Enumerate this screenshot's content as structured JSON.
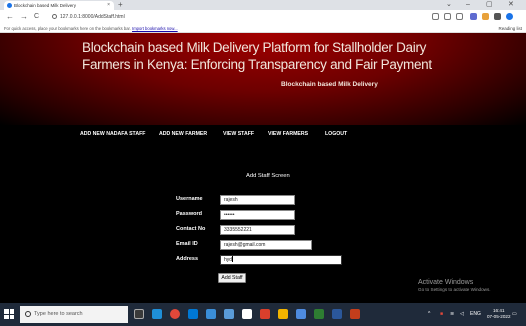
{
  "browser": {
    "tab_title": "Blockchain based Milk Delivery",
    "tab_close": "×",
    "new_tab": "+",
    "window_controls": [
      "⌄",
      "–",
      "▢",
      "✕"
    ],
    "nav": {
      "back": "←",
      "forward": "→",
      "reload": "C"
    },
    "url": "127.0.0.1:8000/AddStaff.html",
    "bookmarks_text": "For quick access, place your bookmarks here on the bookmarks bar.",
    "bookmarks_link": "Import bookmarks now...",
    "reading_list": "Reading list"
  },
  "header": {
    "title": "Blockchain based Milk Delivery Platform for Stallholder Dairy Farmers in Kenya: Enforcing Transparency and Fair Payment",
    "subtitle": "Blockchain based Milk Delivery"
  },
  "nav": {
    "items": [
      "ADD NEW NADAFA STAFF",
      "ADD NEW FARMER",
      "VIEW STAFF",
      "VIEW FARMERS",
      "LOGOUT"
    ]
  },
  "form": {
    "title": "Add Staff Screen",
    "fields": [
      {
        "label": "Username",
        "value": "rajesh"
      },
      {
        "label": "Password",
        "value": "••••••"
      },
      {
        "label": "Contact No",
        "value": "3335552221"
      },
      {
        "label": "Email ID",
        "value": "rajesh@gmail.com"
      },
      {
        "label": "Address",
        "value": "hyd"
      }
    ],
    "submit_label": "Add Staff"
  },
  "watermark": {
    "line1": "Activate Windows",
    "line2": "Go to Settings to activate Windows."
  },
  "taskbar": {
    "search_placeholder": "Type here to search",
    "time": "16:41",
    "date": "07-05-2022",
    "language": "ENG"
  },
  "colors": {
    "header_red": "#a30000",
    "page_bg": "#000000",
    "taskbar_bg": "#1f2a3a"
  }
}
